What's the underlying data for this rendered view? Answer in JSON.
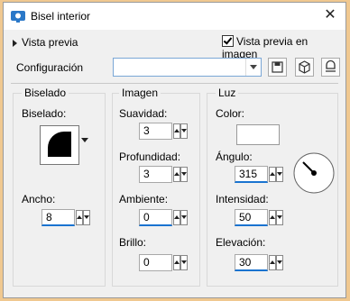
{
  "window": {
    "title": "Bisel interior",
    "close_glyph": "✕"
  },
  "top": {
    "preview_toggle": "Vista previa",
    "preview_in_image": "Vista previa en imagen",
    "preview_in_image_checked": true
  },
  "config": {
    "label": "Configuración",
    "value": ""
  },
  "bevel": {
    "group_title": "Biselado",
    "bevel_label": "Biselado:",
    "width_label": "Ancho:",
    "width_value": "8"
  },
  "image": {
    "group_title": "Imagen",
    "smoothness_label": "Suavidad:",
    "smoothness_value": "3",
    "depth_label": "Profundidad:",
    "depth_value": "3",
    "ambient_label": "Ambiente:",
    "ambient_value": "0",
    "brightness_label": "Brillo:",
    "brightness_value": "0"
  },
  "light": {
    "group_title": "Luz",
    "color_label": "Color:",
    "color_value": "#ffffff",
    "angle_label": "Ángulo:",
    "angle_value": "315",
    "intensity_label": "Intensidad:",
    "intensity_value": "50",
    "elevation_label": "Elevación:",
    "elevation_value": "30"
  },
  "colors": {
    "accent": "#1a73d0",
    "outer_frame": "#f0c890",
    "dialog_bg": "#f0f0f0"
  }
}
